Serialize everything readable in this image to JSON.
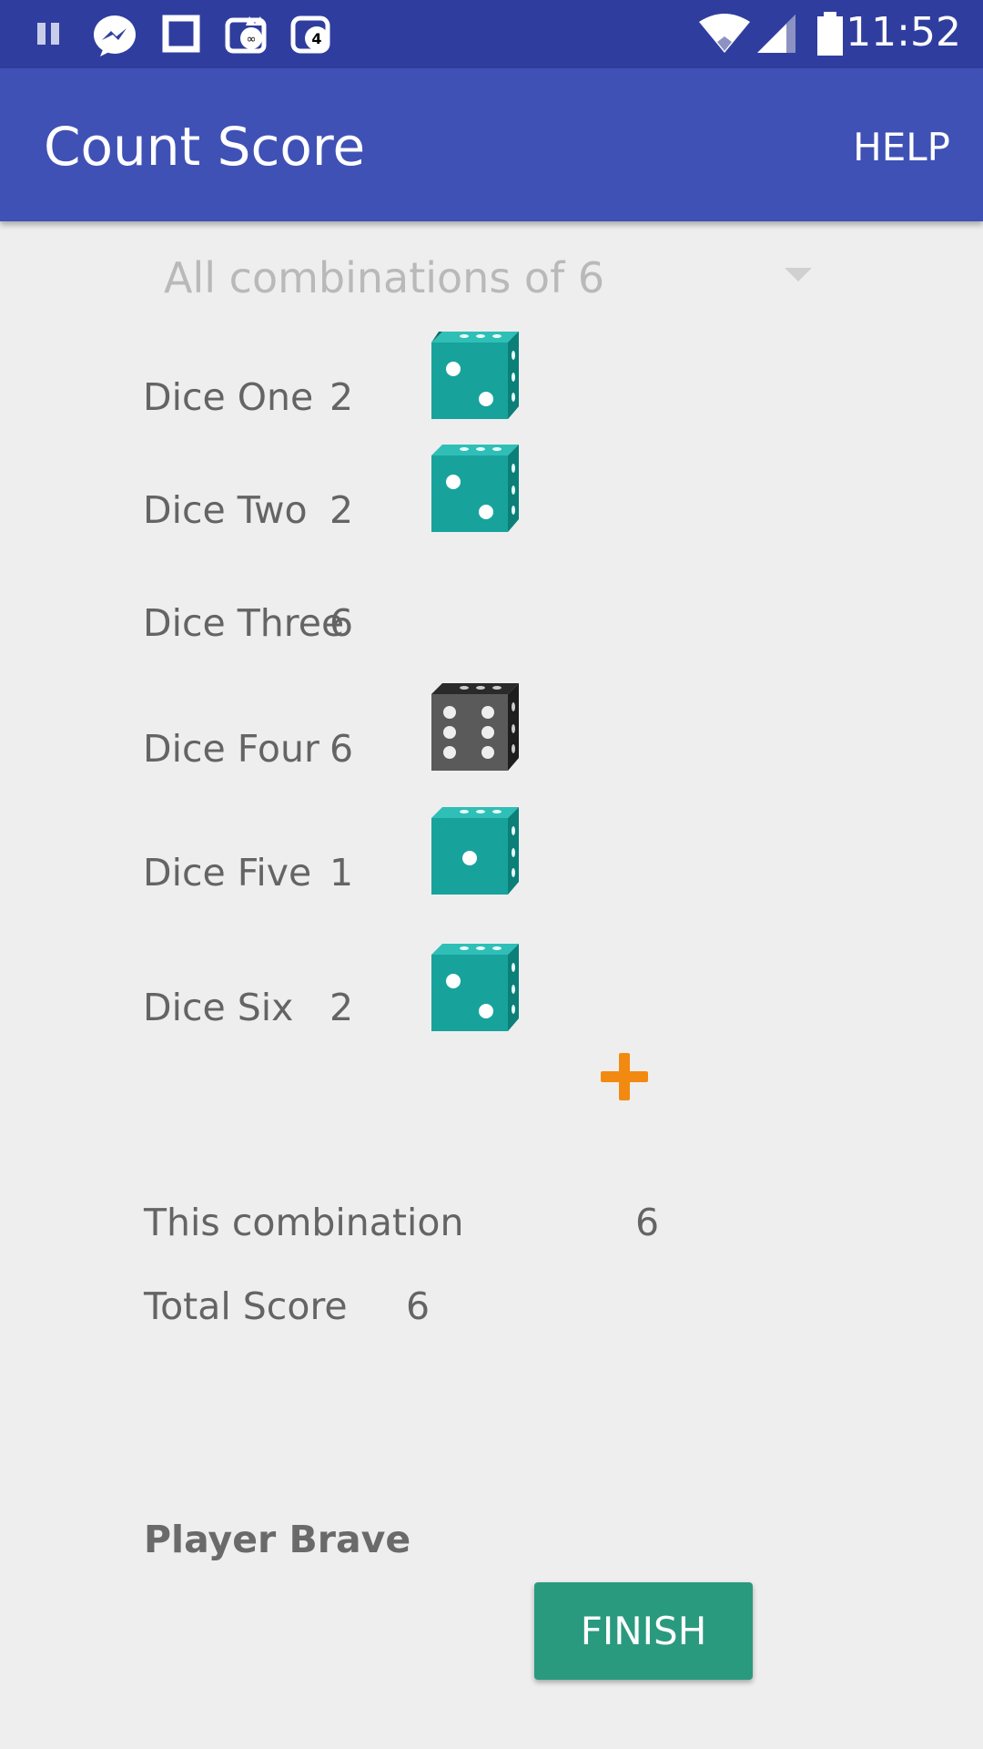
{
  "status_bar": {
    "time": "11:52",
    "icons": [
      "pause-icon",
      "messenger-icon",
      "square-icon",
      "cat-infinity-icon",
      "notification-4-icon",
      "wifi-icon",
      "signal-icon",
      "battery-icon"
    ],
    "notification_count": "4"
  },
  "app_bar": {
    "title": "Count Score",
    "help_label": "HELP"
  },
  "combination_spinner": {
    "selected": "All combinations of 6"
  },
  "dice": [
    {
      "label": "Dice One",
      "value": "2",
      "die_face": 2,
      "die_color": "teal"
    },
    {
      "label": "Dice Two",
      "value": "2",
      "die_face": 2,
      "die_color": "teal"
    },
    {
      "label": "Dice Three",
      "value": "6",
      "die_face": null,
      "die_color": null
    },
    {
      "label": "Dice Four",
      "value": "6",
      "die_face": 6,
      "die_color": "black"
    },
    {
      "label": "Dice Five",
      "value": "1",
      "die_face": 1,
      "die_color": "teal"
    },
    {
      "label": "Dice Six",
      "value": "2",
      "die_face": 2,
      "die_color": "teal"
    }
  ],
  "summary": {
    "combination_label": "This combination",
    "combination_value": "6",
    "total_label": "Total Score",
    "total_value": "6"
  },
  "player": {
    "name": "Player Brave"
  },
  "finish_label": "FINISH",
  "colors": {
    "status_bar": "#2f3e9e",
    "app_bar": "#3f51b5",
    "background": "#eeeeee",
    "teal_die": "#17a39c",
    "black_die": "#3a3a3a",
    "plus": "#f28a12",
    "finish_button": "#2a9a7f"
  }
}
